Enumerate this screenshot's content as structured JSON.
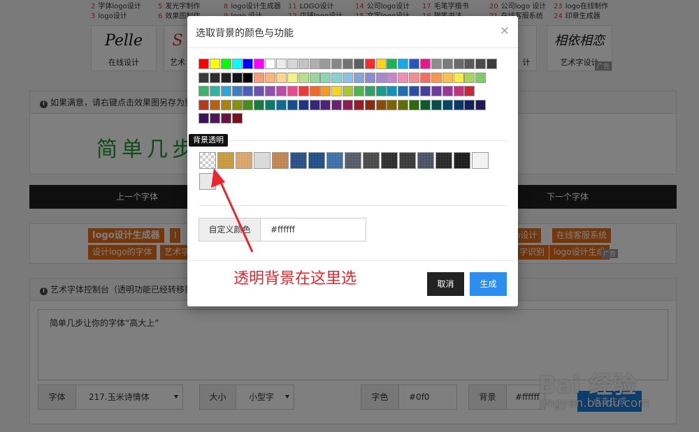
{
  "top_links": [
    {
      "n": "2",
      "text": "字体logo设计"
    },
    {
      "n": "5",
      "text": "发光字制作"
    },
    {
      "n": "8",
      "text": "logo设计生成器"
    },
    {
      "n": "11",
      "text": "LOGO设计"
    },
    {
      "n": "14",
      "text": "公司logo设计"
    },
    {
      "n": "17",
      "text": "毛笔字楷书"
    },
    {
      "n": "20",
      "text": "公司logo 设计"
    },
    {
      "n": "23",
      "text": "logo在线制作"
    },
    {
      "n": "3",
      "text": "logo设计"
    },
    {
      "n": "6",
      "text": "效果图制作"
    },
    {
      "n": "9",
      "text": "logo 设计"
    },
    {
      "n": "12",
      "text": "店铺logo设计"
    },
    {
      "n": "15",
      "text": "文字logo设计"
    },
    {
      "n": "18",
      "text": "钢笔书法"
    },
    {
      "n": "21",
      "text": "在线客服系统"
    },
    {
      "n": "24",
      "text": "印章生成器"
    }
  ],
  "thumbs": {
    "left_caption": "在线设计",
    "mid_caption": "艺术",
    "right_partial": "计",
    "right_caption": "艺术字设计",
    "ad": "广告",
    "left_art": "Pelle",
    "right_art": "相依相恋"
  },
  "result_panel": {
    "hint": "如果满意，请右键点击效果图另存为到",
    "preview_text": "简单几步"
  },
  "navbar": {
    "prev": "上一个字体",
    "next": "下一个字体"
  },
  "tags": {
    "row1": [
      "logo设计生成器",
      "l",
      "o设计",
      "在线客服系统"
    ],
    "row2": [
      "设计logo的字体",
      "艺术字",
      "字识别",
      "logo设计生成"
    ],
    "ad": "广告"
  },
  "console": {
    "header": "艺术字体控制台（透明功能已经转移到",
    "textarea": "简单几步让你的字体“高大上”",
    "font_label": "字体",
    "font_value": "217.玉米诗情体",
    "size_label": "大小",
    "size_value": "小型字",
    "color_label": "字色",
    "color_value": "#0f0",
    "bg_label": "背景",
    "bg_value": "#ffffff",
    "gen_button": "点击生成"
  },
  "watermark": {
    "brand": "Bai 经验",
    "url": "jingyan.baidu.com"
  },
  "modal": {
    "title": "选取背景的颜色与功能",
    "close": "×",
    "tooltip": "背景透明",
    "custom_label": "自定义颜色",
    "custom_value": "#ffffff",
    "annotation": "透明背景在这里选",
    "cancel": "取消",
    "generate": "生成",
    "swatch_rows": [
      [
        "#ff0000",
        "#ffff00",
        "#00ff00",
        "#00ffff",
        "#0000ff",
        "#ff00ff",
        "#ffffff",
        "#ebebeb",
        "#d7d7d7",
        "#c3c3c3",
        "#afafaf",
        "#9b9b9b",
        "#878787",
        "#737373",
        "#5f5f5f",
        "#ff2b2b",
        "#ffd21e",
        "#1ab356",
        "#17a9e6",
        "#2a54c2",
        "#e6198a",
        "#8c8c8c",
        "#7a7a7a",
        "#6a6a6a",
        "#5a5a5a",
        "#4a4a4a",
        "#3c3c3c"
      ],
      [
        "#3a3a3a",
        "#2e2e2e",
        "#222222",
        "#141414",
        "#000000",
        "#f59c7a",
        "#f7b680",
        "#fbd690",
        "#f6f08a",
        "#b6e08d",
        "#99d69a",
        "#8ed5b3",
        "#84d4d2",
        "#8ac3e8",
        "#86a4dc",
        "#8d8cd3",
        "#a588cf",
        "#c487c9",
        "#f08db3",
        "#f08f8f",
        "#f26e5e",
        "#f7964f",
        "#fbbf4b",
        "#f6ec4b",
        "#a6d65a",
        "#7fcc63"
      ],
      [
        "#39b56b",
        "#2ab8a2",
        "#2aa7d4",
        "#3d7dc9",
        "#4a5db8",
        "#6a52b0",
        "#8e4fb0",
        "#bb4ca6",
        "#e84c8a",
        "#ec3a3a",
        "#f06a25",
        "#f79b1b",
        "#f5d61c",
        "#a8c92e",
        "#4cb84b",
        "#2da463",
        "#159e8a",
        "#1194b8",
        "#1c6fb3",
        "#2d4ca3",
        "#4b3d9e",
        "#6e3a9e",
        "#953a99",
        "#c2327c",
        "#c9263a"
      ],
      [
        "#b23c1a",
        "#b8600f",
        "#a8820c",
        "#87910f",
        "#4a8a1e",
        "#187a3c",
        "#0f786e",
        "#0e6c90",
        "#144f8c",
        "#1f357c",
        "#35287a",
        "#4f227a",
        "#6d1f73",
        "#8f1b58",
        "#9a1a28",
        "#8b2a0f",
        "#8e4a08",
        "#7f6206",
        "#616d08",
        "#2f6713",
        "#0d5b2a",
        "#084f49",
        "#064866",
        "#0a3763",
        "#141f5e",
        "#25175c"
      ],
      [
        "#3a135c",
        "#521358",
        "#6b1244",
        "#7a0f1e"
      ]
    ],
    "textures": [
      "transparent",
      "#c89a40",
      "#d8a56a",
      "#d9d9d9",
      "#c08450",
      "#2a4f86",
      "#1f4f86",
      "#3f6fa8",
      "#555b68",
      "#4a4a4a",
      "#2e2e2e",
      "#3a3a3a",
      "#4a5363",
      "#2a2a2a",
      "#1c1c1c",
      "#f2f2f2",
      "#e8e8e8"
    ]
  }
}
